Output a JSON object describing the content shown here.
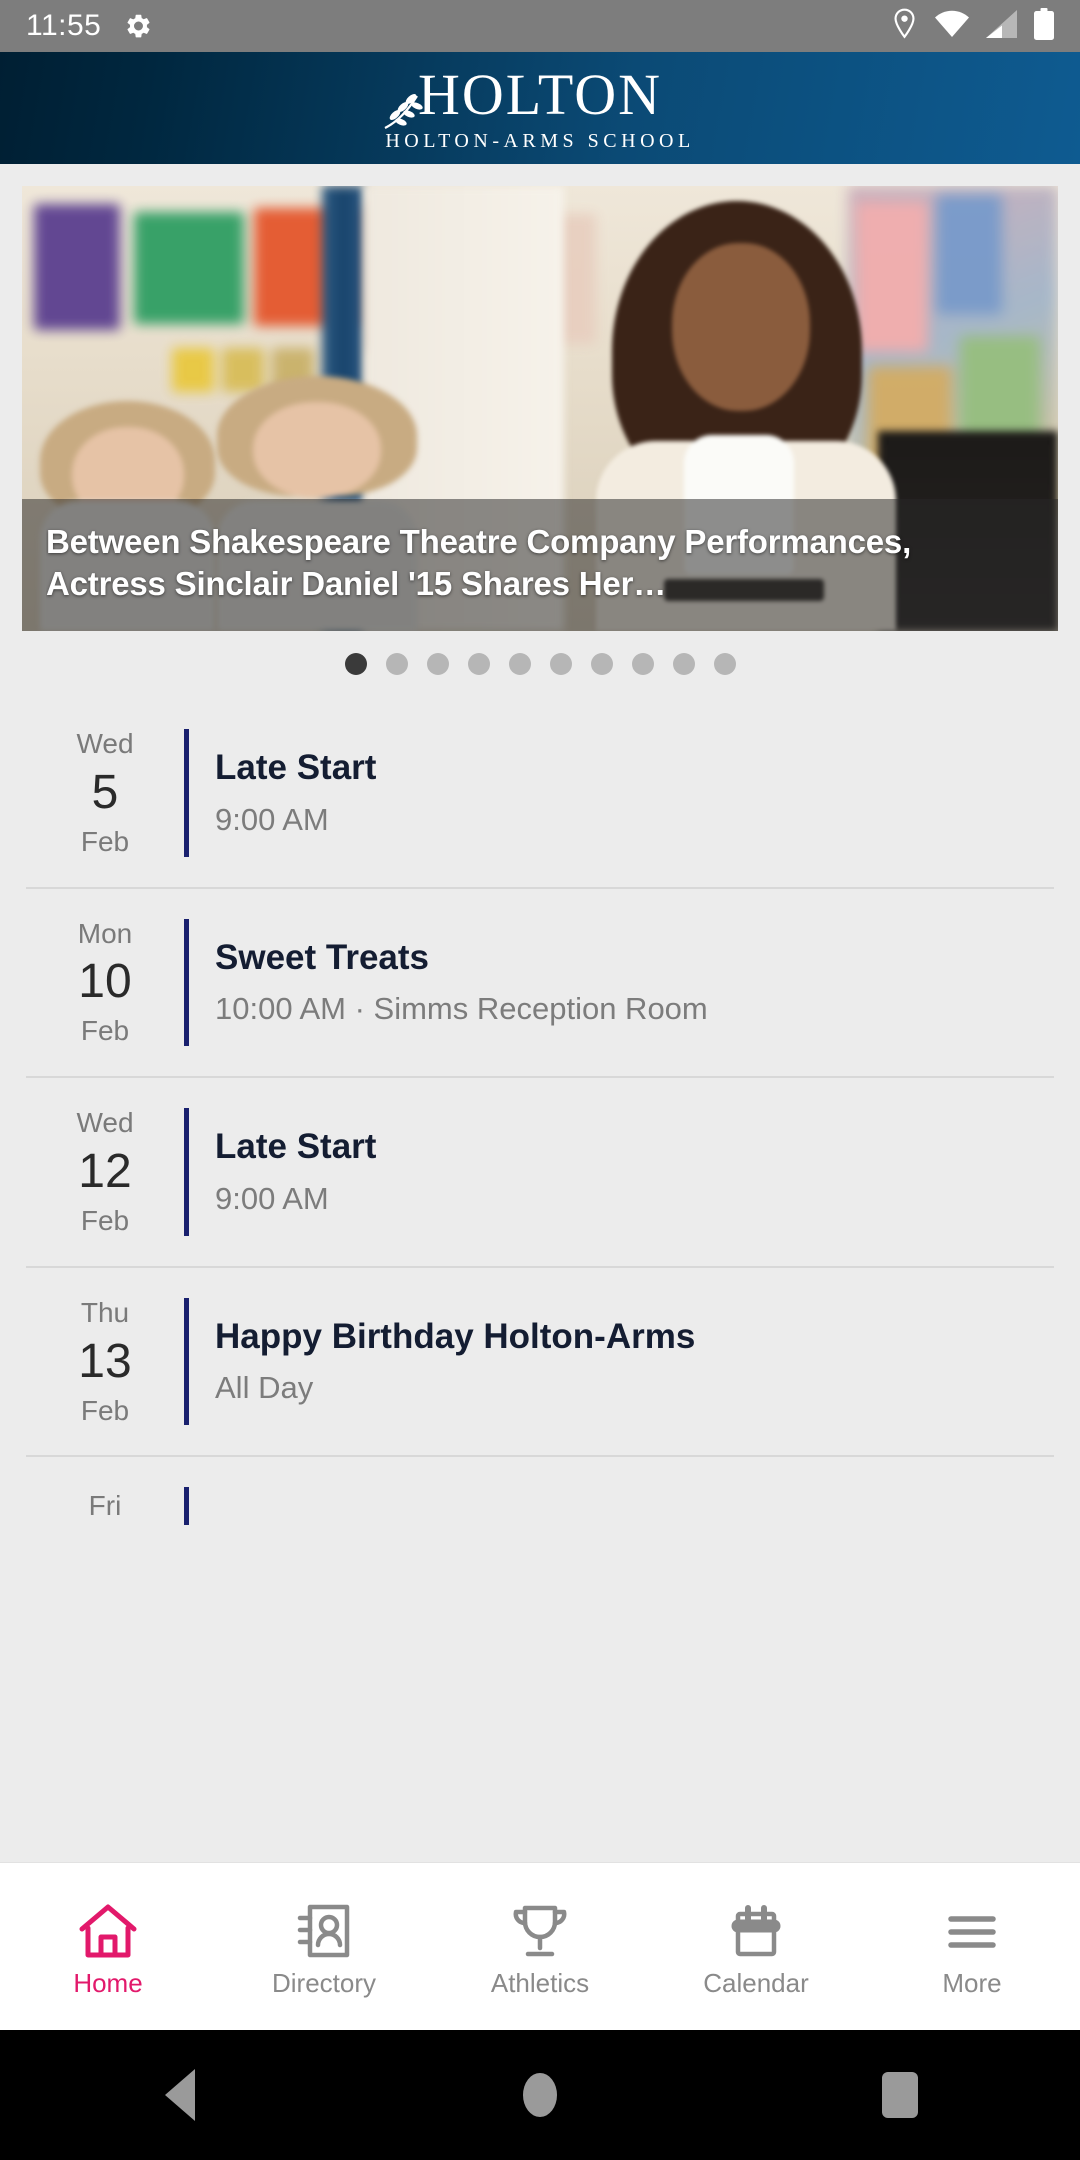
{
  "status_bar": {
    "time": "11:55",
    "icons": [
      "gear-icon",
      "location-pin-icon",
      "wifi-icon",
      "cellular-signal-icon",
      "battery-icon"
    ]
  },
  "header": {
    "logo_main": "HOLTON",
    "logo_sub": "HOLTON-ARMS SCHOOL",
    "gradient_from": "#001f33",
    "gradient_to": "#0e5b91"
  },
  "hero": {
    "caption": "Between Shakespeare Theatre Company Performances, Actress Sinclair Daniel '15 Shares Her…",
    "dots_total": 10,
    "active_dot": 1
  },
  "events": [
    {
      "dow": "Wed",
      "day": "5",
      "month": "Feb",
      "title": "Late Start",
      "meta": "9:00 AM"
    },
    {
      "dow": "Mon",
      "day": "10",
      "month": "Feb",
      "title": "Sweet Treats",
      "meta": "10:00 AM · Simms Reception Room"
    },
    {
      "dow": "Wed",
      "day": "12",
      "month": "Feb",
      "title": "Late Start",
      "meta": "9:00 AM"
    },
    {
      "dow": "Thu",
      "day": "13",
      "month": "Feb",
      "title": "Happy Birthday Holton-Arms",
      "meta": "All Day"
    }
  ],
  "partial_event": {
    "dow": "Fri"
  },
  "tabbar": {
    "active_color": "#e2196b",
    "inactive_color": "#8a8a8a",
    "items": [
      {
        "label": "Home",
        "icon": "home-icon",
        "active": true
      },
      {
        "label": "Directory",
        "icon": "contact-book-icon",
        "active": false
      },
      {
        "label": "Athletics",
        "icon": "trophy-icon",
        "active": false
      },
      {
        "label": "Calendar",
        "icon": "calendar-icon",
        "active": false
      },
      {
        "label": "More",
        "icon": "hamburger-menu-icon",
        "active": false
      }
    ]
  },
  "android_nav": {
    "back": "back-icon",
    "home": "home-circle-icon",
    "recents": "recents-icon"
  }
}
